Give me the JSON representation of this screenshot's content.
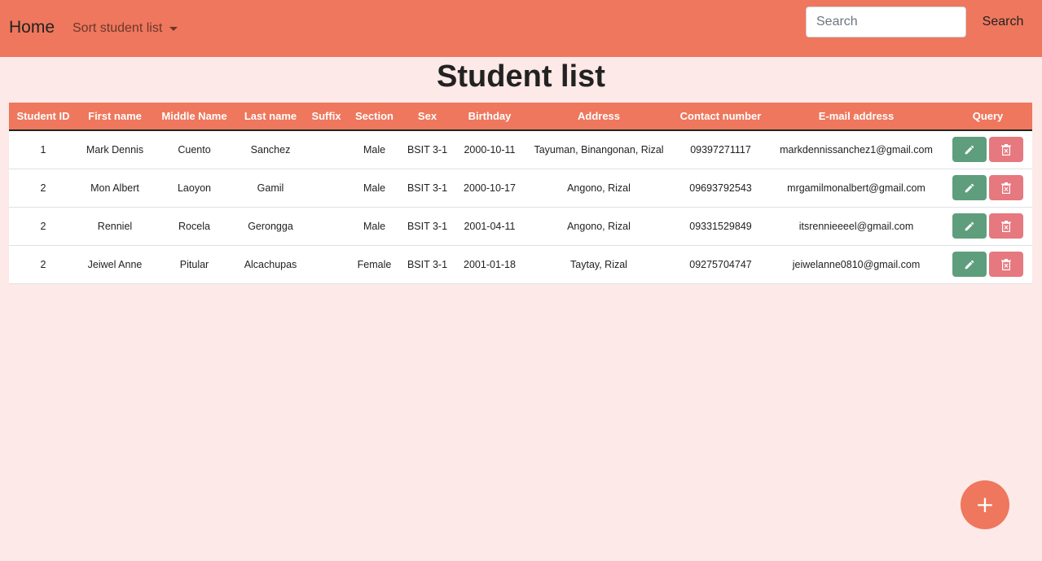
{
  "navbar": {
    "brand": "Home",
    "sort_label": "Sort student list",
    "search_placeholder": "Search",
    "search_button": "Search"
  },
  "page_title": "Student list",
  "table": {
    "headers": [
      "Student ID",
      "First name",
      "Middle Name",
      "Last name",
      "Suffix",
      "Section",
      "Sex",
      "Birthday",
      "Address",
      "Contact number",
      "E-mail address",
      "Query"
    ],
    "rows": [
      {
        "id": "1",
        "first": "Mark Dennis",
        "middle": "Cuento",
        "last": "Sanchez",
        "suffix": "",
        "section": "Male",
        "sex": "BSIT 3-1",
        "birthday": "2000-10-11",
        "address": "Tayuman, Binangonan, Rizal",
        "contact": "09397271117",
        "email": "markdennissanchez1@gmail.com"
      },
      {
        "id": "2",
        "first": "Mon Albert",
        "middle": "Laoyon",
        "last": "Gamil",
        "suffix": "",
        "section": "Male",
        "sex": "BSIT 3-1",
        "birthday": "2000-10-17",
        "address": "Angono, Rizal",
        "contact": "09693792543",
        "email": "mrgamilmonalbert@gmail.com"
      },
      {
        "id": "2",
        "first": "Renniel",
        "middle": "Rocela",
        "last": "Gerongga",
        "suffix": "",
        "section": "Male",
        "sex": "BSIT 3-1",
        "birthday": "2001-04-11",
        "address": "Angono, Rizal",
        "contact": "09331529849",
        "email": "itsrennieeeel@gmail.com"
      },
      {
        "id": "2",
        "first": "Jeiwel Anne",
        "middle": "Pitular",
        "last": "Alcachupas",
        "suffix": "",
        "section": "Female",
        "sex": "BSIT 3-1",
        "birthday": "2001-01-18",
        "address": "Taytay, Rizal",
        "contact": "09275704747",
        "email": "jeiwelanne0810@gmail.com"
      }
    ]
  },
  "icons": {
    "edit": "pencil-icon",
    "delete": "trash-icon",
    "add": "plus-icon"
  },
  "fab_label": "+",
  "colors": {
    "primary": "#ee775d",
    "background": "#fde9e7",
    "edit": "#5e9e7c",
    "delete": "#e6787f"
  }
}
